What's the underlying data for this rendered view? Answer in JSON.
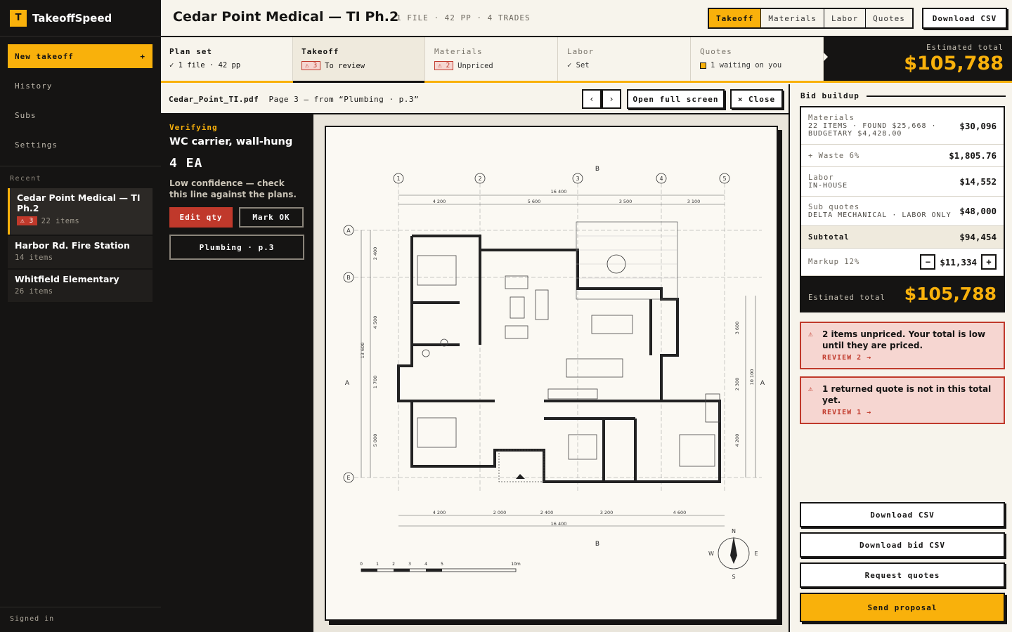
{
  "brand": {
    "logo_letter": "T",
    "name": "TakeoffSpeed"
  },
  "sidebar": {
    "new_takeoff": "New takeoff",
    "new_takeoff_plus": "+",
    "nav": [
      "History",
      "Subs",
      "Settings"
    ],
    "recent_label": "Recent",
    "recent": [
      {
        "title": "Cedar Point Medical — TI Ph.2",
        "badge": "⚠ 3",
        "meta": "22 items"
      },
      {
        "title": "Harbor Rd. Fire Station",
        "meta": "14 items"
      },
      {
        "title": "Whitfield Elementary",
        "meta": "26 items"
      }
    ],
    "signed_in": "Signed in"
  },
  "header": {
    "title": "Cedar Point Medical — TI Ph.2",
    "meta": "1 FILE · 42 PP · 4 TRADES",
    "tabs": [
      "Takeoff",
      "Materials",
      "Labor",
      "Quotes"
    ],
    "download": "Download CSV"
  },
  "steps": [
    {
      "label": "Plan set",
      "sub": "✓ 1 file · 42 pp"
    },
    {
      "label": "Takeoff",
      "badge": "⚠ 3",
      "sub": "To review"
    },
    {
      "label": "Materials",
      "badge": "⚠ 2",
      "sub": "Unpriced"
    },
    {
      "label": "Labor",
      "sub": "✓ Set"
    },
    {
      "label": "Quotes",
      "sub": "1 waiting on you"
    }
  ],
  "estimate": {
    "label": "Estimated total",
    "value": "$105,788"
  },
  "viewer": {
    "file": "Cedar_Point_TI.pdf",
    "page_info": "Page 3 — from “Plumbing · p.3”",
    "prev": "‹",
    "next": "›",
    "fullscreen": "Open full screen",
    "close": "× Close"
  },
  "verify": {
    "kicker": "Verifying",
    "item": "WC carrier, wall-hung",
    "qty": "4  EA",
    "note": "Low confidence — check this line against the plans.",
    "edit": "Edit qty",
    "ok": "Mark OK",
    "source": "Plumbing · p.3"
  },
  "plan": {
    "grid_cols": [
      "1",
      "2",
      "3",
      "4",
      "5"
    ],
    "grid_rows": [
      "A",
      "B",
      "E"
    ],
    "top_total": "16 400",
    "top_dims": [
      "4 200",
      "5 600",
      "3 500",
      "3 100"
    ],
    "bottom_dims": [
      "4 200",
      "2 000",
      "2 400",
      "3 200",
      "4 600"
    ],
    "bottom_total": "16 400",
    "left_dims": [
      "2 400",
      "4 500",
      "1 700",
      "5 000"
    ],
    "left_total": "13 600",
    "right_dims": [
      "3 600",
      "2 300",
      "4 200"
    ],
    "right_total": "10 100",
    "section_b": "B",
    "section_a": "A",
    "compass": [
      "N",
      "E",
      "S",
      "W"
    ],
    "scale": [
      "0",
      "1",
      "2",
      "3",
      "4",
      "5",
      "10m"
    ]
  },
  "bid": {
    "title": "Bid buildup",
    "materials_label": "Materials",
    "materials_sub": "22 ITEMS · FOUND $25,668 · BUDGETARY $4,428.00",
    "materials_value": "$30,096",
    "waste_label": "+ Waste 6%",
    "waste_value": "$1,805.76",
    "labor_label": "Labor",
    "labor_sub": "IN-HOUSE",
    "labor_value": "$14,552",
    "subs_label": "Sub quotes",
    "subs_sub": "DELTA MECHANICAL · LABOR ONLY",
    "subs_value": "$48,000",
    "subtotal_label": "Subtotal",
    "subtotal_value": "$94,454",
    "markup_label": "Markup 12%",
    "markup_minus": "−",
    "markup_value": "$11,334",
    "markup_plus": "+",
    "total_label": "Estimated total",
    "total_value": "$105,788"
  },
  "alerts": [
    {
      "icon": "⚠",
      "msg": "2 items unpriced. Your total is low until they are priced.",
      "link": "REVIEW 2 →"
    },
    {
      "icon": "⚠",
      "msg": "1 returned quote is not in this total yet.",
      "link": "REVIEW 1 →"
    }
  ],
  "actions": [
    "Download CSV",
    "Download bid CSV",
    "Request quotes",
    "Send proposal"
  ],
  "colors": {
    "accent": "#f9b10b",
    "dark": "#151413",
    "danger": "#c0392b",
    "paper": "#f7f4ec"
  }
}
